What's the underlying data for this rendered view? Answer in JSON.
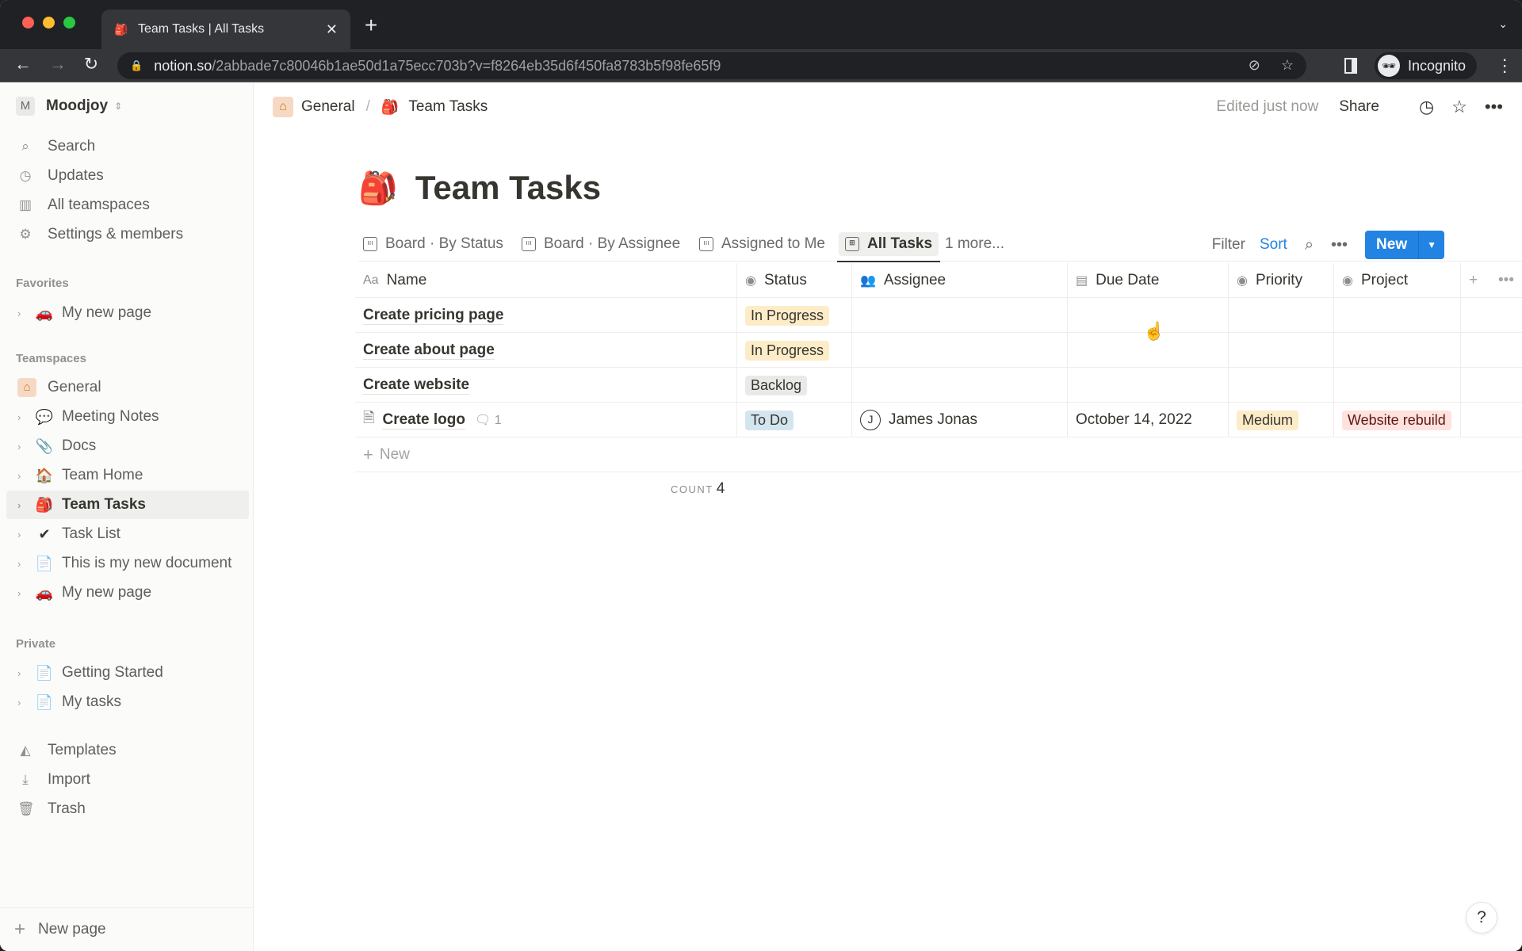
{
  "browser": {
    "tab_title": "Team Tasks | All Tasks",
    "url_host": "notion.so",
    "url_path": "/2abbade7c80046b1ae50d1a75ecc703b?v=f8264eb35d6f450fa8783b5f98fe65f9",
    "profile_label": "Incognito"
  },
  "sidebar": {
    "workspace_initial": "M",
    "workspace_name": "Moodjoy",
    "top_items": [
      {
        "label": "Search",
        "icon": "search-icon"
      },
      {
        "label": "Updates",
        "icon": "clock-icon"
      },
      {
        "label": "All teamspaces",
        "icon": "building-icon"
      },
      {
        "label": "Settings & members",
        "icon": "gear-icon"
      }
    ],
    "favorites_heading": "Favorites",
    "favorites": [
      {
        "label": "My new page",
        "emoji": "🚗"
      }
    ],
    "teamspaces_heading": "Teamspaces",
    "teamspace_name": "General",
    "teamspace_pages": [
      {
        "label": "Meeting Notes",
        "emoji": "💬"
      },
      {
        "label": "Docs",
        "emoji": "📎"
      },
      {
        "label": "Team Home",
        "emoji": "🏠"
      },
      {
        "label": "Team Tasks",
        "emoji": "🎒",
        "active": true
      },
      {
        "label": "Task List",
        "emoji": "✔"
      },
      {
        "label": "This is my new document",
        "emoji": "📄"
      },
      {
        "label": "My new page",
        "emoji": "🚗"
      }
    ],
    "private_heading": "Private",
    "private_pages": [
      {
        "label": "Getting Started",
        "emoji": "📄"
      },
      {
        "label": "My tasks",
        "emoji": "📄"
      }
    ],
    "bottom_items": [
      {
        "label": "Templates",
        "icon": "templates-icon"
      },
      {
        "label": "Import",
        "icon": "import-icon"
      },
      {
        "label": "Trash",
        "icon": "trash-icon"
      }
    ],
    "new_page_label": "New page"
  },
  "topbar": {
    "breadcrumb": [
      "General",
      "Team Tasks"
    ],
    "edited_label": "Edited just now",
    "share_label": "Share"
  },
  "page": {
    "title": "Team Tasks",
    "views": [
      {
        "label": "Board · By Status",
        "type": "board"
      },
      {
        "label": "Board · By Assignee",
        "type": "board"
      },
      {
        "label": "Assigned to Me",
        "type": "board"
      },
      {
        "label": "All Tasks",
        "type": "table",
        "active": true
      }
    ],
    "more_views_label": "1 more...",
    "filter_label": "Filter",
    "sort_label": "Sort",
    "new_label": "New",
    "colors": {
      "accent": "#2383e2",
      "sort_active": "#2383e2"
    }
  },
  "table": {
    "columns": [
      "Name",
      "Status",
      "Assignee",
      "Due Date",
      "Priority",
      "Project"
    ],
    "rows": [
      {
        "name": "Create pricing page",
        "status": "In Progress",
        "status_bg": "#fdecc8",
        "assignee": "",
        "due": "",
        "priority": "",
        "project": ""
      },
      {
        "name": "Create about page",
        "status": "In Progress",
        "status_bg": "#fdecc8",
        "assignee": "",
        "due": "",
        "priority": "",
        "project": ""
      },
      {
        "name": "Create website",
        "status": "Backlog",
        "status_bg": "#e9e9e7",
        "assignee": "",
        "due": "",
        "priority": "",
        "project": ""
      },
      {
        "name": "Create logo",
        "has_doc_icon": true,
        "comment_count": "1",
        "status": "To Do",
        "status_bg": "#d3e5ef",
        "assignee_initial": "J",
        "assignee": "James Jonas",
        "due": "October 14, 2022",
        "priority": "Medium",
        "priority_bg": "#fdecc8",
        "project": "Website rebuild",
        "project_bg": "#ffe2dd"
      }
    ],
    "new_row_label": "New",
    "count_label": "COUNT",
    "count_value": "4"
  },
  "help_label": "?"
}
